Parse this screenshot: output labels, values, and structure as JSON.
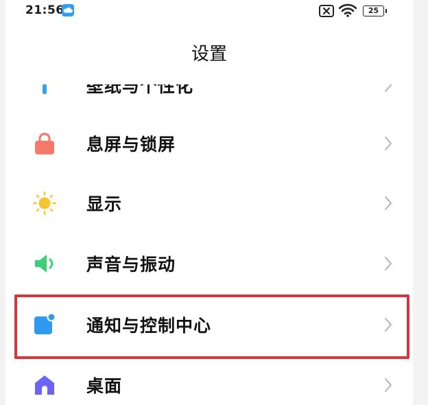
{
  "status_bar": {
    "time": "21:56",
    "battery_level": "25"
  },
  "header": {
    "title": "设置"
  },
  "settings": {
    "items": [
      {
        "label": "壁纸与个性化",
        "icon": "wallpaper-icon",
        "color": "#3aa0f0"
      },
      {
        "label": "息屏与锁屏",
        "icon": "lock-icon",
        "color": "#f47a6c"
      },
      {
        "label": "显示",
        "icon": "sun-icon",
        "color": "#f7c531"
      },
      {
        "label": "声音与振动",
        "icon": "speaker-icon",
        "color": "#3ccf7a"
      },
      {
        "label": "通知与控制中心",
        "icon": "notification-icon",
        "color": "#2e9bf0"
      },
      {
        "label": "桌面",
        "icon": "home-icon",
        "color": "#6b64f5"
      }
    ]
  },
  "highlight": {
    "color": "#d9343a",
    "target": "通知与控制中心"
  }
}
